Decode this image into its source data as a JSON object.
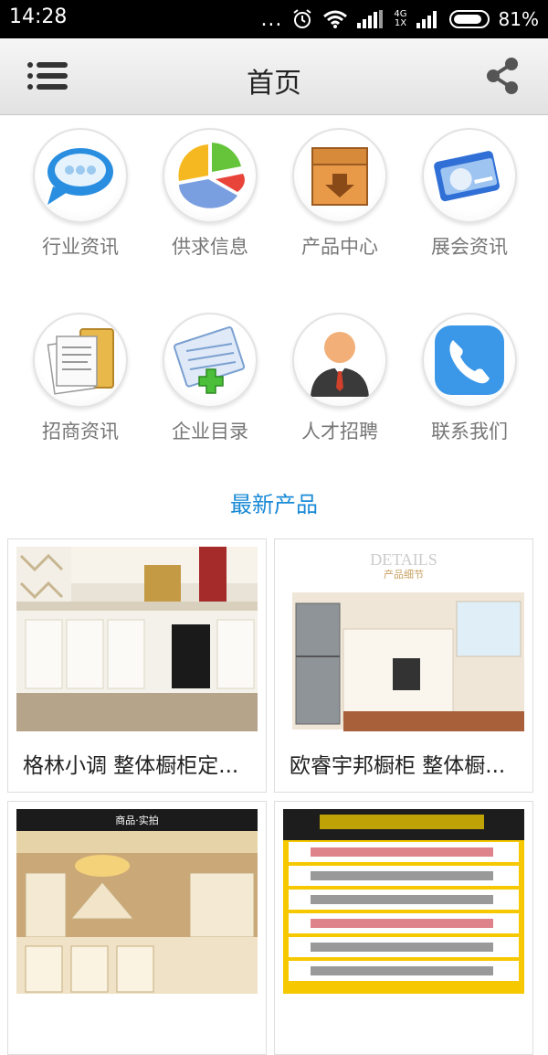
{
  "status_bar": {
    "time": "14:28",
    "dots": "...",
    "network_label_top": "4G",
    "network_label_bottom": "1X",
    "battery": "81%"
  },
  "header": {
    "title": "首页"
  },
  "categories": [
    {
      "label": "行业资讯",
      "icon": "chat-bubble-icon"
    },
    {
      "label": "供求信息",
      "icon": "pie-chart-icon"
    },
    {
      "label": "产品中心",
      "icon": "crate-icon"
    },
    {
      "label": "展会资讯",
      "icon": "card-globe-icon"
    },
    {
      "label": "招商资讯",
      "icon": "documents-icon"
    },
    {
      "label": "企业目录",
      "icon": "notepad-plus-icon"
    },
    {
      "label": "人才招聘",
      "icon": "person-icon"
    },
    {
      "label": "联系我们",
      "icon": "phone-icon"
    }
  ],
  "latest_products": {
    "title": "最新产品",
    "items": [
      {
        "name": "格林小调 整体橱柜定..."
      },
      {
        "name": "欧睿宇邦橱柜 整体橱..."
      },
      {
        "name": ""
      },
      {
        "name": ""
      }
    ]
  },
  "image_texts": {
    "details_heading": "DETAILS",
    "details_sub": "产品细节",
    "photo_banner": "商品·实拍"
  }
}
